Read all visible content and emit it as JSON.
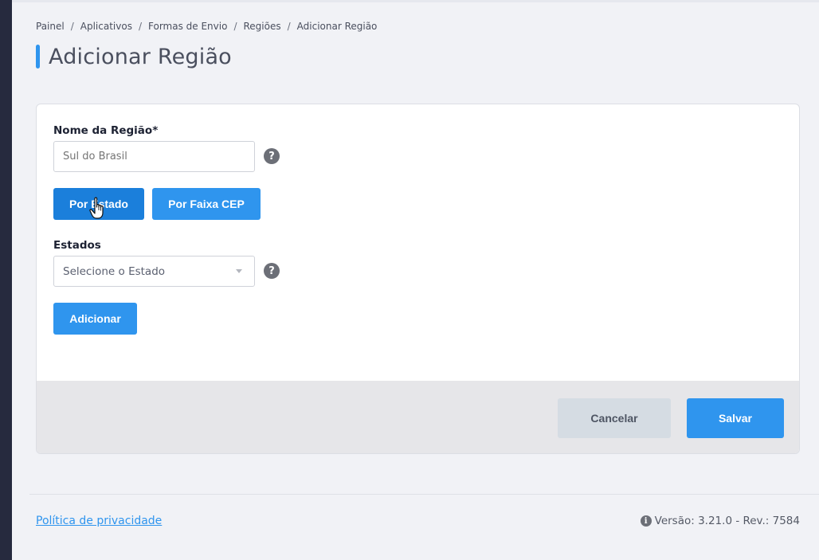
{
  "breadcrumb": [
    {
      "label": "Painel"
    },
    {
      "label": "Aplicativos"
    },
    {
      "label": "Formas de Envio"
    },
    {
      "label": "Regiões"
    },
    {
      "label": "Adicionar Região"
    }
  ],
  "breadcrumb_separator": "/",
  "page": {
    "title": "Adicionar Região"
  },
  "form": {
    "region_name_label": "Nome da Região*",
    "region_name_placeholder": "Sul do Brasil",
    "region_name_value": "",
    "help_glyph": "?",
    "mode_buttons": {
      "by_state": "Por Estado",
      "by_cep_range": "Por Faixa CEP"
    },
    "active_mode": "by_state",
    "states_label": "Estados",
    "states_select_placeholder": "Selecione o Estado",
    "add_button": "Adicionar"
  },
  "footer_actions": {
    "cancel": "Cancelar",
    "save": "Salvar"
  },
  "page_footer": {
    "privacy_link": "Política de privacidade",
    "info_glyph": "i",
    "version_text": "Versão: 3.21.0 - Rev.: 7584"
  },
  "icons": {
    "help": "help-icon",
    "info": "info-icon",
    "select_caret": "chevron-down-icon",
    "cursor": "hand-pointer-icon"
  },
  "colors": {
    "accent": "#2f95ee",
    "accent_active": "#1b7fdb",
    "sidebar": "#262a3e",
    "cancel_bg": "#d5dce3",
    "footer_bg": "#e6e6e9",
    "page_bg": "#f1f2f6"
  }
}
